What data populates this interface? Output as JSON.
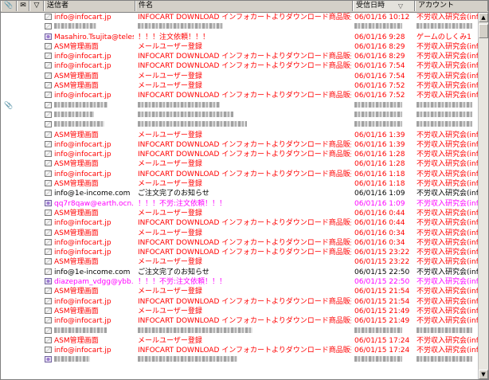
{
  "header": {
    "attach_icon": "📎",
    "status_icon": "✉",
    "flag_icon": "▽",
    "from": "送信者",
    "subject": "件名",
    "date": "受信日時",
    "sort_mark": "▽",
    "account": "アカウント"
  },
  "scroll": {
    "up": "▲",
    "down": "▼"
  },
  "colors": {
    "red": "#ff0000",
    "black": "#000000",
    "magenta": "#ff00ff"
  },
  "rows": [
    {
      "from": "info@infocart.jp",
      "subject": "INFOCART DOWNLOAD インフォカートよりダウンロード商品販売のお知...",
      "date": "06/01/16 10:12",
      "account": "不労収入研究会(inf",
      "color": "red",
      "icon": "mail-read"
    },
    {
      "blur": true,
      "from": "",
      "subject": "",
      "date": "",
      "account": "",
      "color": "red",
      "icon": "mail-read"
    },
    {
      "from": "Masahiro.Tsujita@telesy...",
      "subject": "！！！注文依頼！！！",
      "date": "06/01/16 9:28",
      "account": "ゲームのしくみ1",
      "color": "red",
      "icon": "mail-unread"
    },
    {
      "from": "ASM管理画面",
      "subject": "メールユーザー登録",
      "date": "06/01/16 8:29",
      "account": "不労収入研究会(inf",
      "color": "red",
      "icon": "mail-read"
    },
    {
      "from": "info@infocart.jp",
      "subject": "INFOCART DOWNLOAD インフォカートよりダウンロード商品販売のお知...",
      "date": "06/01/16 8:29",
      "account": "不労収入研究会(inf",
      "color": "red",
      "icon": "mail-read"
    },
    {
      "from": "info@infocart.jp",
      "subject": "INFOCART DOWNLOAD インフォカートよりダウンロード商品販売のお知...",
      "date": "06/01/16 7:54",
      "account": "不労収入研究会(inf",
      "color": "red",
      "icon": "mail-read"
    },
    {
      "from": "ASM管理画面",
      "subject": "メールユーザー登録",
      "date": "06/01/16 7:54",
      "account": "不労収入研究会(inf",
      "color": "red",
      "icon": "mail-read"
    },
    {
      "from": "ASM管理画面",
      "subject": "メールユーザー登録",
      "date": "06/01/16 7:52",
      "account": "不労収入研究会(inf",
      "color": "red",
      "icon": "mail-read"
    },
    {
      "from": "info@infocart.jp",
      "subject": "INFOCART DOWNLOAD インフォカートよりダウンロード商品販売のお知...",
      "date": "06/01/16 7:52",
      "account": "不労収入研究会(inf",
      "color": "red",
      "icon": "mail-read"
    },
    {
      "blur": true,
      "attach": true,
      "from": "",
      "subject": "",
      "date": "",
      "account": "",
      "color": "black",
      "icon": "mail-read"
    },
    {
      "blur": true,
      "from": "",
      "subject": "",
      "date": "",
      "account": "",
      "color": "black",
      "icon": "mail-read"
    },
    {
      "blur": true,
      "from": "",
      "subject": "",
      "date": "",
      "account": "",
      "color": "black",
      "icon": "mail-read"
    },
    {
      "from": "ASM管理画面",
      "subject": "メールユーザー登録",
      "date": "06/01/16 1:39",
      "account": "不労収入研究会(inf",
      "color": "red",
      "icon": "mail-read"
    },
    {
      "from": "info@infocart.jp",
      "subject": "INFOCART DOWNLOAD インフォカートよりダウンロード商品販売のお知...",
      "date": "06/01/16 1:39",
      "account": "不労収入研究会(inf",
      "color": "red",
      "icon": "mail-read"
    },
    {
      "from": "info@infocart.jp",
      "subject": "INFOCART DOWNLOAD インフォカートよりダウンロード商品販売のお知...",
      "date": "06/01/16 1:28",
      "account": "不労収入研究会(inf",
      "color": "red",
      "icon": "mail-read"
    },
    {
      "from": "ASM管理画面",
      "subject": "メールユーザー登録",
      "date": "06/01/16 1:28",
      "account": "不労収入研究会(inf",
      "color": "red",
      "icon": "mail-read"
    },
    {
      "from": "info@infocart.jp",
      "subject": "INFOCART DOWNLOAD インフォカートよりダウンロード商品販売のお知...",
      "date": "06/01/16 1:18",
      "account": "不労収入研究会(inf",
      "color": "red",
      "icon": "mail-read"
    },
    {
      "from": "ASM管理画面",
      "subject": "メールユーザー登録",
      "date": "06/01/16 1:18",
      "account": "不労収入研究会(inf",
      "color": "red",
      "icon": "mail-read"
    },
    {
      "from": "info@1e-income.com",
      "subject": "ご注文完了のお知らせ",
      "date": "06/01/16 1:09",
      "account": "不労収入研究会(inf",
      "color": "black",
      "icon": "mail-read"
    },
    {
      "from": "qq7r8qaw@earth.ocn.ne...",
      "subject": "！！！不労:注文依頼！！！",
      "date": "06/01/16 1:09",
      "account": "不労収入研究会(inf",
      "color": "magenta",
      "icon": "mail-unread"
    },
    {
      "from": "ASM管理画面",
      "subject": "メールユーザー登録",
      "date": "06/01/16 0:44",
      "account": "不労収入研究会(inf",
      "color": "red",
      "icon": "mail-read"
    },
    {
      "from": "info@infocart.jp",
      "subject": "INFOCART DOWNLOAD インフォカートよりダウンロード商品販売のお知...",
      "date": "06/01/16 0:44",
      "account": "不労収入研究会(inf",
      "color": "red",
      "icon": "mail-read"
    },
    {
      "from": "ASM管理画面",
      "subject": "メールユーザー登録",
      "date": "06/01/16 0:34",
      "account": "不労収入研究会(inf",
      "color": "red",
      "icon": "mail-read"
    },
    {
      "from": "info@infocart.jp",
      "subject": "INFOCART DOWNLOAD インフォカートよりダウンロード商品販売のお知...",
      "date": "06/01/16 0:34",
      "account": "不労収入研究会(inf",
      "color": "red",
      "icon": "mail-read"
    },
    {
      "from": "info@infocart.jp",
      "subject": "INFOCART DOWNLOAD インフォカートよりダウンロード商品販売のお知...",
      "date": "06/01/15 23:22",
      "account": "不労収入研究会(inf",
      "color": "red",
      "icon": "mail-read"
    },
    {
      "from": "ASM管理画面",
      "subject": "メールユーザー登録",
      "date": "06/01/15 23:22",
      "account": "不労収入研究会(inf",
      "color": "red",
      "icon": "mail-read"
    },
    {
      "from": "info@1e-income.com",
      "subject": "ご注文完了のお知らせ",
      "date": "06/01/15 22:50",
      "account": "不労収入研究会(inf",
      "color": "black",
      "icon": "mail-read"
    },
    {
      "from": "diazepam_vdgg@ybb.ne.jp",
      "subject": "！！！不労:注文依頼！！！",
      "date": "06/01/15 22:50",
      "account": "不労収入研究会(inf",
      "color": "magenta",
      "icon": "mail-unread"
    },
    {
      "from": "ASM管理画面",
      "subject": "メールユーザー登録",
      "date": "06/01/15 21:54",
      "account": "不労収入研究会(inf",
      "color": "red",
      "icon": "mail-read"
    },
    {
      "from": "info@infocart.jp",
      "subject": "INFOCART DOWNLOAD インフォカートよりダウンロード商品販売のお知...",
      "date": "06/01/15 21:54",
      "account": "不労収入研究会(inf",
      "color": "red",
      "icon": "mail-read"
    },
    {
      "from": "ASM管理画面",
      "subject": "メールユーザー登録",
      "date": "06/01/15 21:49",
      "account": "不労収入研究会(inf",
      "color": "red",
      "icon": "mail-read"
    },
    {
      "from": "info@infocart.jp",
      "subject": "INFOCART DOWNLOAD インフォカートよりダウンロード商品販売のお知...",
      "date": "06/01/15 21:49",
      "account": "不労収入研究会(inf",
      "color": "red",
      "icon": "mail-read"
    },
    {
      "blur": true,
      "from": "",
      "subject": "",
      "date": "",
      "account": "",
      "color": "black",
      "icon": "mail-read"
    },
    {
      "from": "ASM管理画面",
      "subject": "メールユーザー登録",
      "date": "06/01/15 17:24",
      "account": "不労収入研究会(inf",
      "color": "red",
      "icon": "mail-read"
    },
    {
      "from": "info@infocart.jp",
      "subject": "INFOCART DOWNLOAD インフォカートよりダウンロード商品販売のお知...",
      "date": "06/01/15 17:24",
      "account": "不労収入研究会(inf",
      "color": "red",
      "icon": "mail-read"
    },
    {
      "blur": true,
      "from": "",
      "subject": "",
      "date": "",
      "account": "",
      "color": "black",
      "icon": "mail-unread"
    }
  ]
}
